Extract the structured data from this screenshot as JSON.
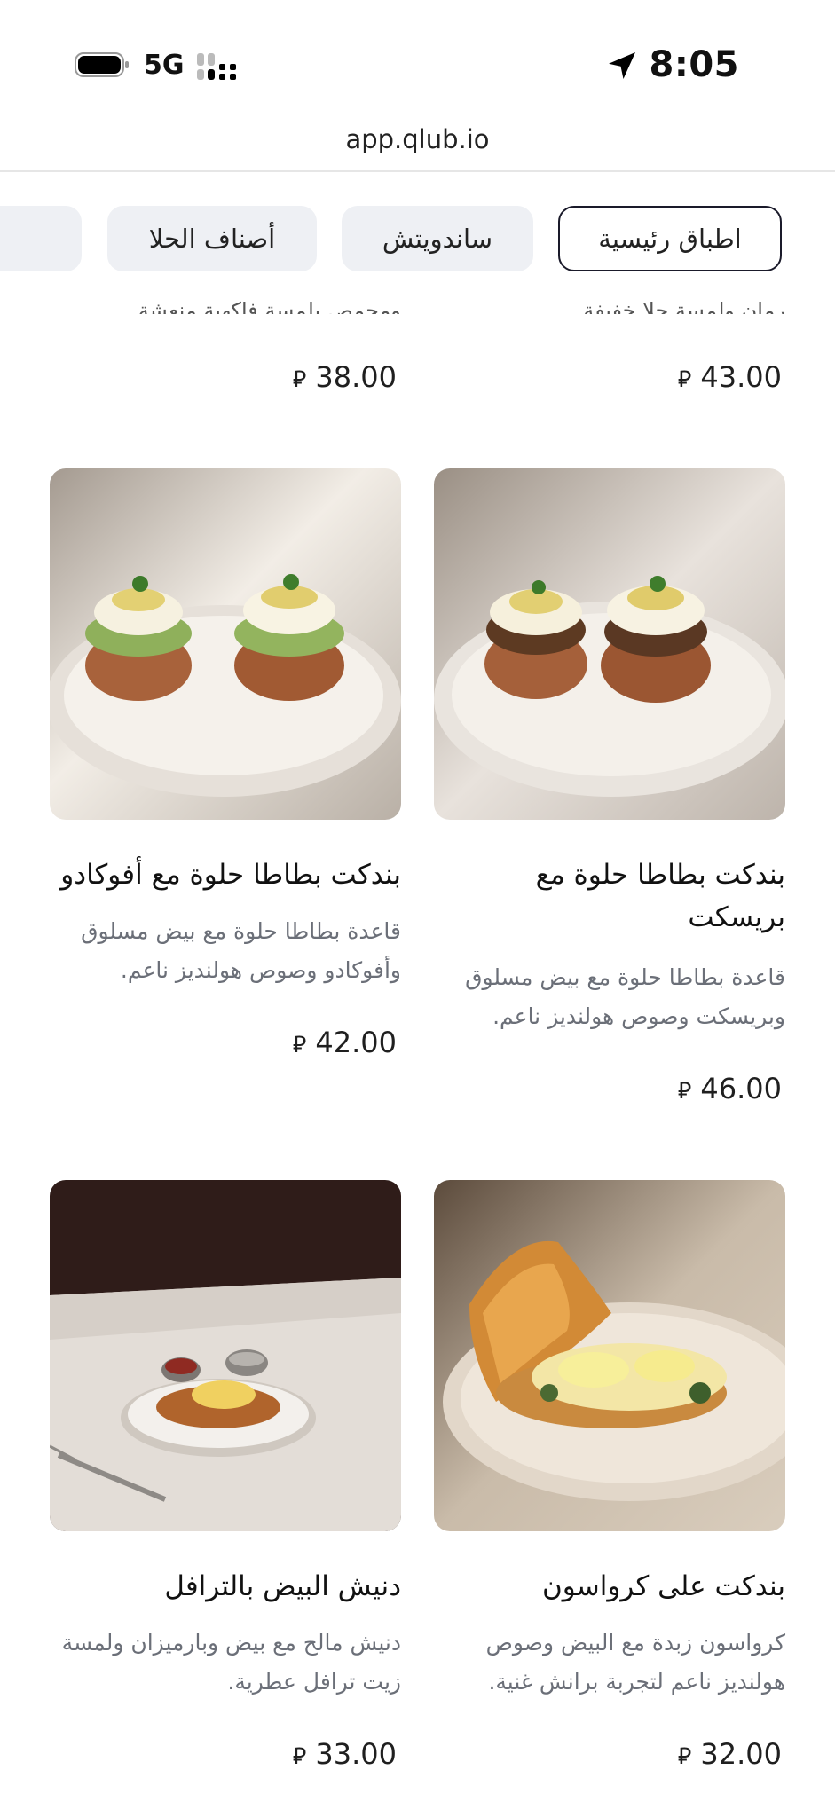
{
  "status_bar": {
    "time": "8:05",
    "network": "5G"
  },
  "browser": {
    "url": "app.qlub.io"
  },
  "tabs": [
    {
      "label": "اطباق رئيسية",
      "active": true
    },
    {
      "label": "ساندويتش",
      "active": false
    },
    {
      "label": "أصناف الحلا",
      "active": false
    }
  ],
  "currency_symbol": "⃁",
  "top_row": [
    {
      "partial_desc": "رمان ولمسة حلا خفيفة.",
      "price": "43.00"
    },
    {
      "partial_desc": "ومحمص بلمسة فاكهية منعشة.",
      "price": "38.00"
    }
  ],
  "items": [
    {
      "title": "بندكت بطاطا حلوة مع بريسكت",
      "desc": "قاعدة بطاطا حلوة مع بيض مسلوق وبريسكت وصوص هولنديز ناعم.",
      "price": "46.00"
    },
    {
      "title": "بندكت بطاطا حلوة مع أفوكادو",
      "desc": "قاعدة بطاطا حلوة مع بيض مسلوق وأفوكادو وصوص هولنديز ناعم.",
      "price": "42.00"
    },
    {
      "title": "بندكت على كرواسون",
      "desc": "كرواسون زبدة مع البيض وصوص هولنديز ناعم لتجربة برانش غنية.",
      "price": "32.00"
    },
    {
      "title": "دنيش البيض بالترافل",
      "desc": "دنيش مالح مع بيض وبارميزان ولمسة زيت ترافل عطرية.",
      "price": "33.00"
    }
  ]
}
